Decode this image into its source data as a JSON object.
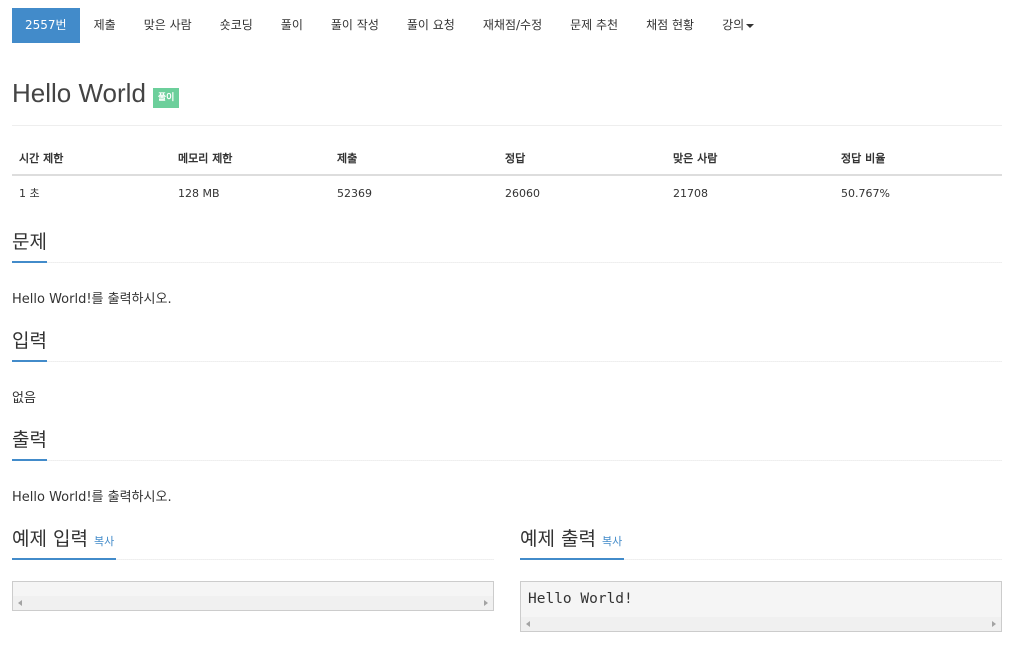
{
  "nav": {
    "items": [
      {
        "label": "2557번",
        "active": true
      },
      {
        "label": "제출"
      },
      {
        "label": "맞은 사람"
      },
      {
        "label": "숏코딩"
      },
      {
        "label": "풀이"
      },
      {
        "label": "풀이 작성"
      },
      {
        "label": "풀이 요청"
      },
      {
        "label": "재채점/수정"
      },
      {
        "label": "문제 추천"
      },
      {
        "label": "채점 현황"
      },
      {
        "label": "강의",
        "dropdown": true
      }
    ]
  },
  "problem": {
    "title": "Hello World",
    "badge": "풀이"
  },
  "info_table": {
    "headers": [
      "시간 제한",
      "메모리 제한",
      "제출",
      "정답",
      "맞은 사람",
      "정답 비율"
    ],
    "row": [
      "1 초",
      "128 MB",
      "52369",
      "26060",
      "21708",
      "50.767%"
    ]
  },
  "sections": {
    "description": {
      "heading": "문제",
      "text": "Hello World!를 출력하시오."
    },
    "input": {
      "heading": "입력",
      "text": "없음"
    },
    "output": {
      "heading": "출력",
      "text": "Hello World!를 출력하시오."
    }
  },
  "samples": {
    "input": {
      "heading": "예제 입력",
      "copy_label": "복사",
      "content": ""
    },
    "output": {
      "heading": "예제 출력",
      "copy_label": "복사",
      "content": "Hello World!"
    }
  },
  "colors": {
    "accent": "#428bca",
    "badge": "#6ccf9b"
  }
}
